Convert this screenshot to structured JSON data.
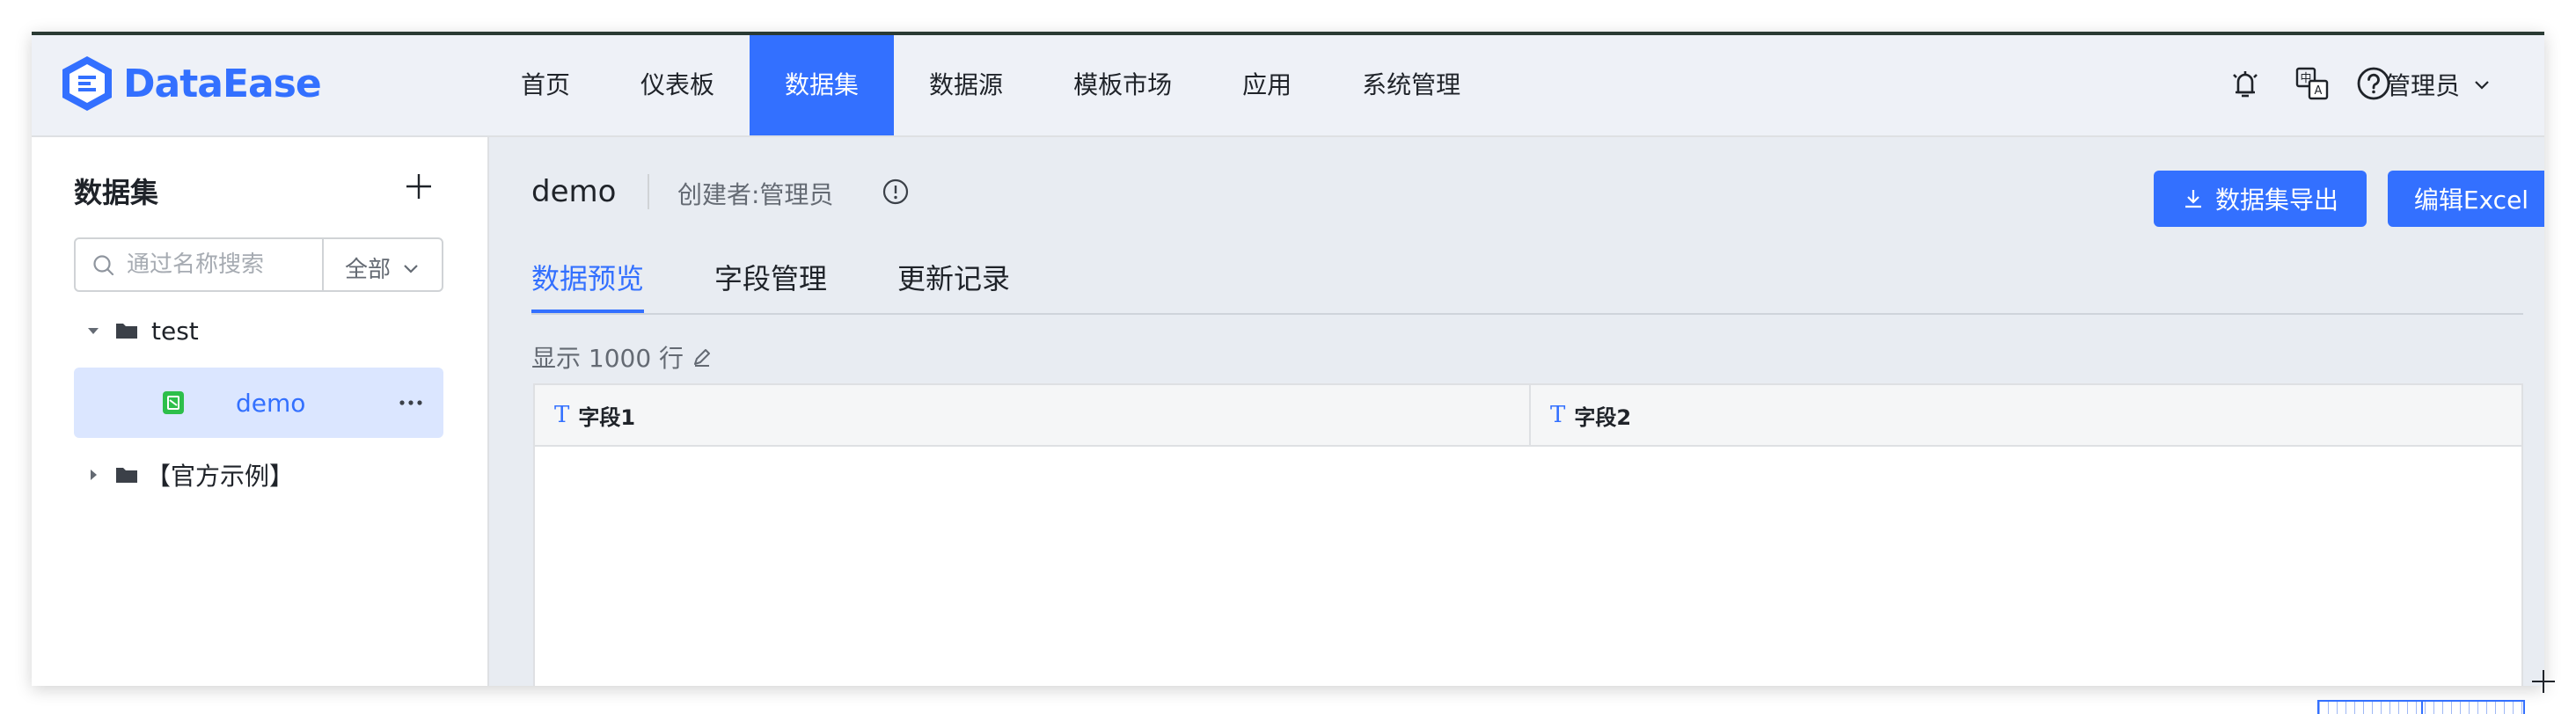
{
  "app": {
    "name": "DataEase"
  },
  "nav": {
    "items": [
      {
        "label": "首页"
      },
      {
        "label": "仪表板"
      },
      {
        "label": "数据集",
        "active": true
      },
      {
        "label": "数据源"
      },
      {
        "label": "模板市场"
      },
      {
        "label": "应用"
      },
      {
        "label": "系统管理"
      }
    ]
  },
  "header": {
    "icons": [
      "notification-icon",
      "language-icon",
      "help-icon"
    ],
    "user_label": "管理员"
  },
  "sidebar": {
    "title": "数据集",
    "search": {
      "placeholder": "通过名称搜索",
      "value": ""
    },
    "filter_label": "全部",
    "tree": [
      {
        "label": "test",
        "expanded": true,
        "type": "folder"
      },
      {
        "label": "demo",
        "type": "dataset",
        "selected": true
      },
      {
        "label": "【官方示例】",
        "expanded": false,
        "type": "folder"
      }
    ]
  },
  "main": {
    "dataset_name": "demo",
    "creator_label": "创建者:管理员",
    "export_button": "数据集导出",
    "edit_excel_button": "编辑Excel",
    "tabs": [
      {
        "label": "数据预览",
        "active": true
      },
      {
        "label": "字段管理"
      },
      {
        "label": "更新记录"
      }
    ],
    "rows_label": "显示 1000 行",
    "table": {
      "type_glyph": "T",
      "columns": [
        "字段1",
        "字段2"
      ],
      "rows": []
    }
  },
  "colors": {
    "accent": "#3370ff",
    "header_bg": "#eef1f7",
    "main_bg": "#e8ecf2",
    "selected_bg": "#dbe6ff",
    "dataset_icon": "#2dbf4a"
  }
}
